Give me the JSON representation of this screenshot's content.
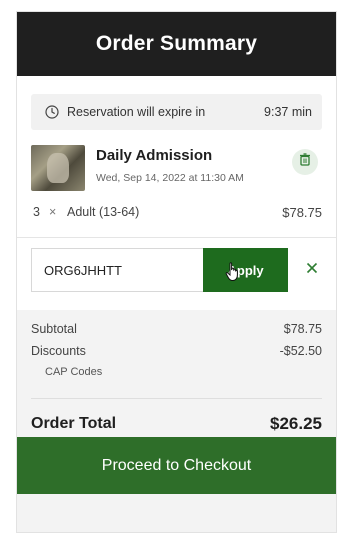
{
  "header": {
    "title": "Order Summary"
  },
  "reservation": {
    "label": "Reservation will expire in",
    "time": "9:37 min"
  },
  "item": {
    "title": "Daily Admission",
    "date": "Wed, Sep 14, 2022 at 11:30 AM",
    "ticket": {
      "qty": "3",
      "times": "×",
      "label": "Adult (13-64)",
      "price": "$78.75"
    }
  },
  "promo": {
    "code": "ORG6JHHTT",
    "apply_label": "Apply",
    "clear_symbol": "×"
  },
  "totals": {
    "subtotal_label": "Subtotal",
    "subtotal_value": "$78.75",
    "discounts_label": "Discounts",
    "discounts_value": "-$52.50",
    "cap_codes_label": "CAP Codes",
    "order_total_label": "Order Total",
    "order_total_value": "$26.25"
  },
  "checkout": {
    "label": "Proceed to Checkout"
  },
  "colors": {
    "header_bg": "#1f1f1f",
    "accent_green": "#1e6b1e",
    "checkout_green": "#2e6e29"
  }
}
